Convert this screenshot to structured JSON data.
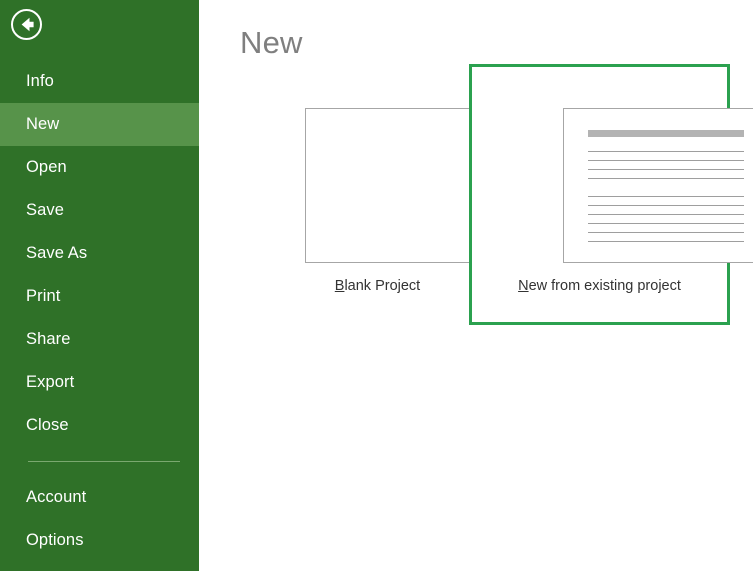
{
  "window": {
    "app_accent_color": "#2f7128",
    "selection_color": "#2ba14f"
  },
  "sidebar": {
    "back_button": {
      "name": "back-arrow-icon",
      "label": "Back"
    },
    "items": [
      {
        "label": "Info",
        "selected": false,
        "divider_before": false
      },
      {
        "label": "New",
        "selected": true,
        "divider_before": false
      },
      {
        "label": "Open",
        "selected": false,
        "divider_before": false
      },
      {
        "label": "Save",
        "selected": false,
        "divider_before": false
      },
      {
        "label": "Save As",
        "selected": false,
        "divider_before": false
      },
      {
        "label": "Print",
        "selected": false,
        "divider_before": false
      },
      {
        "label": "Share",
        "selected": false,
        "divider_before": false
      },
      {
        "label": "Export",
        "selected": false,
        "divider_before": false
      },
      {
        "label": "Close",
        "selected": false,
        "divider_before": false
      },
      {
        "label": "Account",
        "selected": false,
        "divider_before": true
      },
      {
        "label": "Options",
        "selected": false,
        "divider_before": false
      }
    ]
  },
  "main": {
    "title": "New",
    "templates": [
      {
        "id": "blank",
        "accel": "B",
        "caption_rest": "lank Project",
        "caption_full": "Blank Project",
        "selected": false,
        "thumb_type": "empty"
      },
      {
        "id": "existing",
        "accel": "N",
        "caption_rest": "ew from existing project",
        "caption_full": "New from existing project",
        "selected": true,
        "thumb_type": "document-preview"
      }
    ]
  },
  "thumbnail_preview": {
    "header_bar": true,
    "group_one_lines": 4,
    "group_two_lines": 6
  }
}
